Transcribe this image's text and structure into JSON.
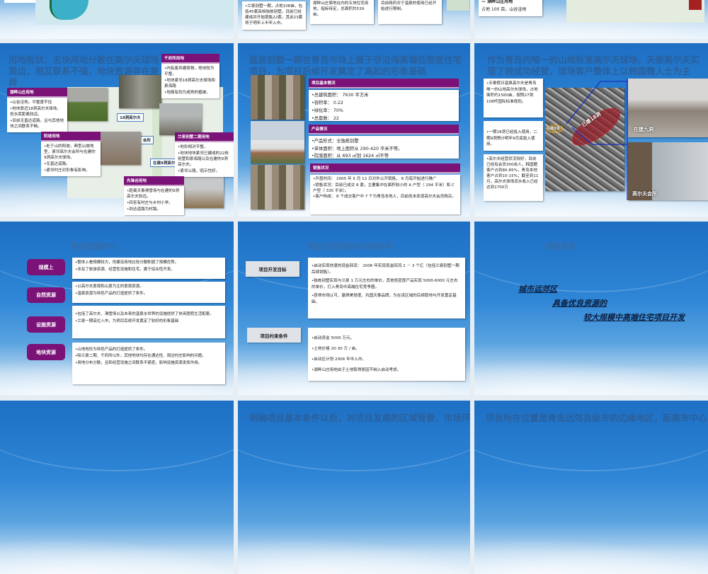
{
  "row1": {
    "slide_b": {
      "box1": "•兰泉别墅一期，占地108亩，包括45套高档独栋别墅，目前已经建成并开始销售22套，其余23套将于明年上半年入市。",
      "box2": "湖周地，先锋谷周地，阳坡地，湖畔山庄周地在内的五块住宅用地，指标待定，总面积共539亩。",
      "box3": "温泉，在整个城中只此一处，但目前政府对于温泉的使用已经开始进行限制。"
    },
    "slide_c": {
      "label": "— 湖畔山庄用地",
      "text": "占地 100 亩，山谷洼地"
    }
  },
  "slide_land": {
    "title": "用地现状：五块用地分散在高尔夫球场周边，相互联系不强，地块资源存在差异",
    "map_labels": [
      "18洞高尔夫",
      "在建9洞高尔夫",
      "会所"
    ],
    "cards": [
      {
        "header": "千府所用地",
        "items": [
          "•内有废弃建筑物，地块较为平整。",
          "•地块紧邻18洞高尔夫球场和泉海路",
          "•地面有较为成熟的植被。"
        ]
      },
      {
        "header": "湖畔山庄用地",
        "items": [
          "•山谷洼地，平整度不佳",
          "•地块靠近18洞高尔夫球场，但水库距离较远。",
          "•目前无直达道路，且与其他地块之间联系不畅。"
        ]
      },
      {
        "header": "阳坡用地",
        "items": [
          "•处于山的阳坡，典型山坡地型，紧邻高尔夫会所与在建的9洞高尔夫球场。",
          "•无直达道路。",
          "•紧邻村庄对形象有影响。"
        ]
      },
      {
        "header": "兰泉别墅二期用地",
        "items": [
          "•地形相对平整。",
          "•地块地块紧邻已建成的22栋别墅和泉海路以及在建的9洞高尔夫。",
          "•紧邻公路，昭示性好。"
        ]
      },
      {
        "header": "先锋谷用地",
        "items": [
          "•距离天泰滑雪场与在建的9洞高尔夫较远。",
          "•四至有村庄与乡村小学。",
          "•到达道路为村路。"
        ]
      }
    ]
  },
  "slide_villa": {
    "title": "蓝泉别墅一期在青岛市场上属于非沿海高端低密度住宅项目，为项目后续开发奠定了高起的形象基础",
    "sections": [
      {
        "header": "项目基本情况",
        "items": [
          "•总建筑面积： 7630 平方米",
          "•容积率： 0.22",
          "•绿化率： 70%",
          "•总套数： 22"
        ]
      },
      {
        "header": "产品情况",
        "items": [
          "•产品形式：全独栋别墅",
          "•单体面积：地上面积从 290-420 平米不等。",
          "•院落面积：从 693 ㎡到 1624 ㎡不等"
        ]
      },
      {
        "header": "销售状况",
        "items": [
          "•开盘时间： 2005 年 5 月 12 日对外公开销售， 8 月底开始进行推广",
          "•销售状况：目前已成交 8 套，主要集中在面积较小的 A 户型（ 294 平米）和 C 户型（ 335 平米）。",
          "•客户构成： 8 个成交客户中 7 个为青岛本地人，目前尚未发现高尔夫会员购买。"
        ]
      }
    ]
  },
  "slide_golf": {
    "title": "作为青岛的唯一的山地标准高尔夫球场，天泰高尔夫实现了较成功经营，球场客户整体上以韩国籍人士为主",
    "boxes": [
      "•天泰假日温泉高尔夫是青岛唯一的山地高尔夫球场，占地面积约1580亩，按照27洞108杆国际标准规划。",
      "•一期18洞已经投入使用，二期9洞预计明年9月底投入使用。",
      "•高尔夫经营状况较好，目前已经有会员300余人，韩国籍客户占到80-85%，青岛本地客户占到10-15%；截至到11月，高尔夫球场流水收入已经达到1700万"
    ],
    "map_labels": [
      "已建18洞",
      "在建9洞"
    ],
    "photo_labels": [
      "在建九洞",
      "高尔夫会所"
    ]
  },
  "slide_resources": {
    "title": "项目资源评价",
    "rows": [
      {
        "tag": "规模上",
        "items": [
          "•整体上看规模较大，但建设用地比较分散削弱了规模优势。",
          "•涉及了旅游资源、经营性设施和住宅，属于综合性开发。"
        ]
      },
      {
        "tag": "自然资源",
        "items": [
          "•以高尔夫景观和山景为主的景观资源。",
          "•温泉资源为特色产品的打造提供了条件。"
        ]
      },
      {
        "tag": "设施资源",
        "items": [
          "•包括了高尔夫、滑雪场以及未来的温泉水世界的设施提供了休闲度假生活配套。",
          "•兰泉一期高位入市，为项目后续开发奠定了较好的形象基础"
        ]
      },
      {
        "tag": "地块资源",
        "items": [
          "•山地地形为特色产品的打造提供了条件。",
          "•除兰泉二期、千府所以外，其他地块均存在通达性、周边村庄影响的问题。",
          "•用地分布分散，且和经营设施之间联系不紧密，影响设施资源发挥作用。"
        ]
      }
    ]
  },
  "slide_goals": {
    "title": "项目开发目标与约束条件",
    "goal_label": "项目开发目标",
    "goal_items": [
      "•启动实现快速的现金回流： 2006 年实现现金回流 2 － 3 个亿（包括兰泉别墅一期后续销售）。",
      "•独栋别墅实现与兰泉 1 万元左右的单价，其他低密度产品实现 5000-6000 元左右的单价，打入青岛中高端住宅竞争圈。",
      "•获得市场认可、赢得美誉度、巩固天泰品牌，为在该区域的后续取地与开发奠定基础。"
    ],
    "constraint_label": "项目约束条件",
    "constraint_items": [
      "•启动资金 5000 万元。",
      "•土地价格 20-30 万 / 亩。",
      "•启动区计划 2006 年中入市。",
      "•湖畔山庄用地由于土地取得原因不纳入启动考虑。"
    ]
  },
  "slide_define": {
    "title": "项目界定",
    "lines": [
      "城市远郊区",
      "具备优良资源的",
      "较大规模中高端住宅项目开发"
    ]
  },
  "row4": {
    "slide_b_title": "明确项目基本条件以后，对项目发展的区域背景、市场环",
    "slide_c_title": "项目所在位置是青岛远郊县级市的边缘地区，距离市中心"
  },
  "colors": {
    "purple": "#7a1278",
    "sky": "#2f86d6",
    "title": "#2c5d95"
  }
}
